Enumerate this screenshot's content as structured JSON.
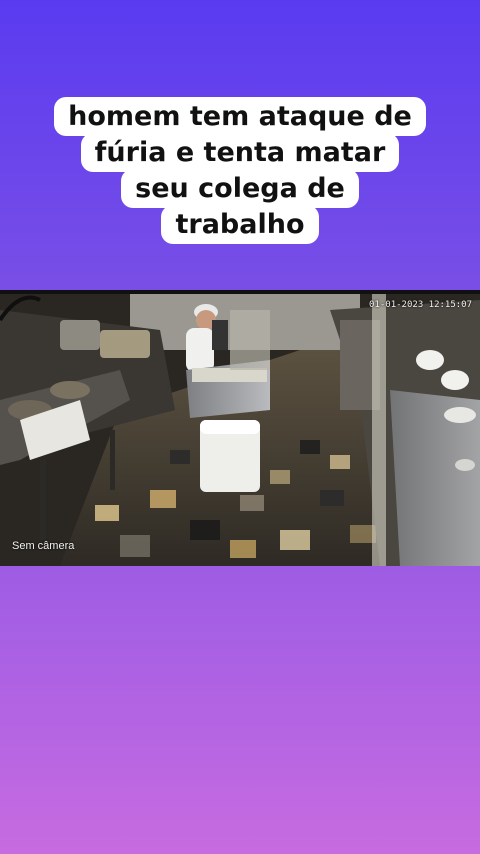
{
  "caption": {
    "lines": [
      "homem tem ataque de",
      "fúria e tenta matar",
      "seu colega de",
      "trabalho"
    ]
  },
  "video": {
    "camera_label": "Sem câmera",
    "timestamp": "01-01-2023 12:15:07"
  }
}
